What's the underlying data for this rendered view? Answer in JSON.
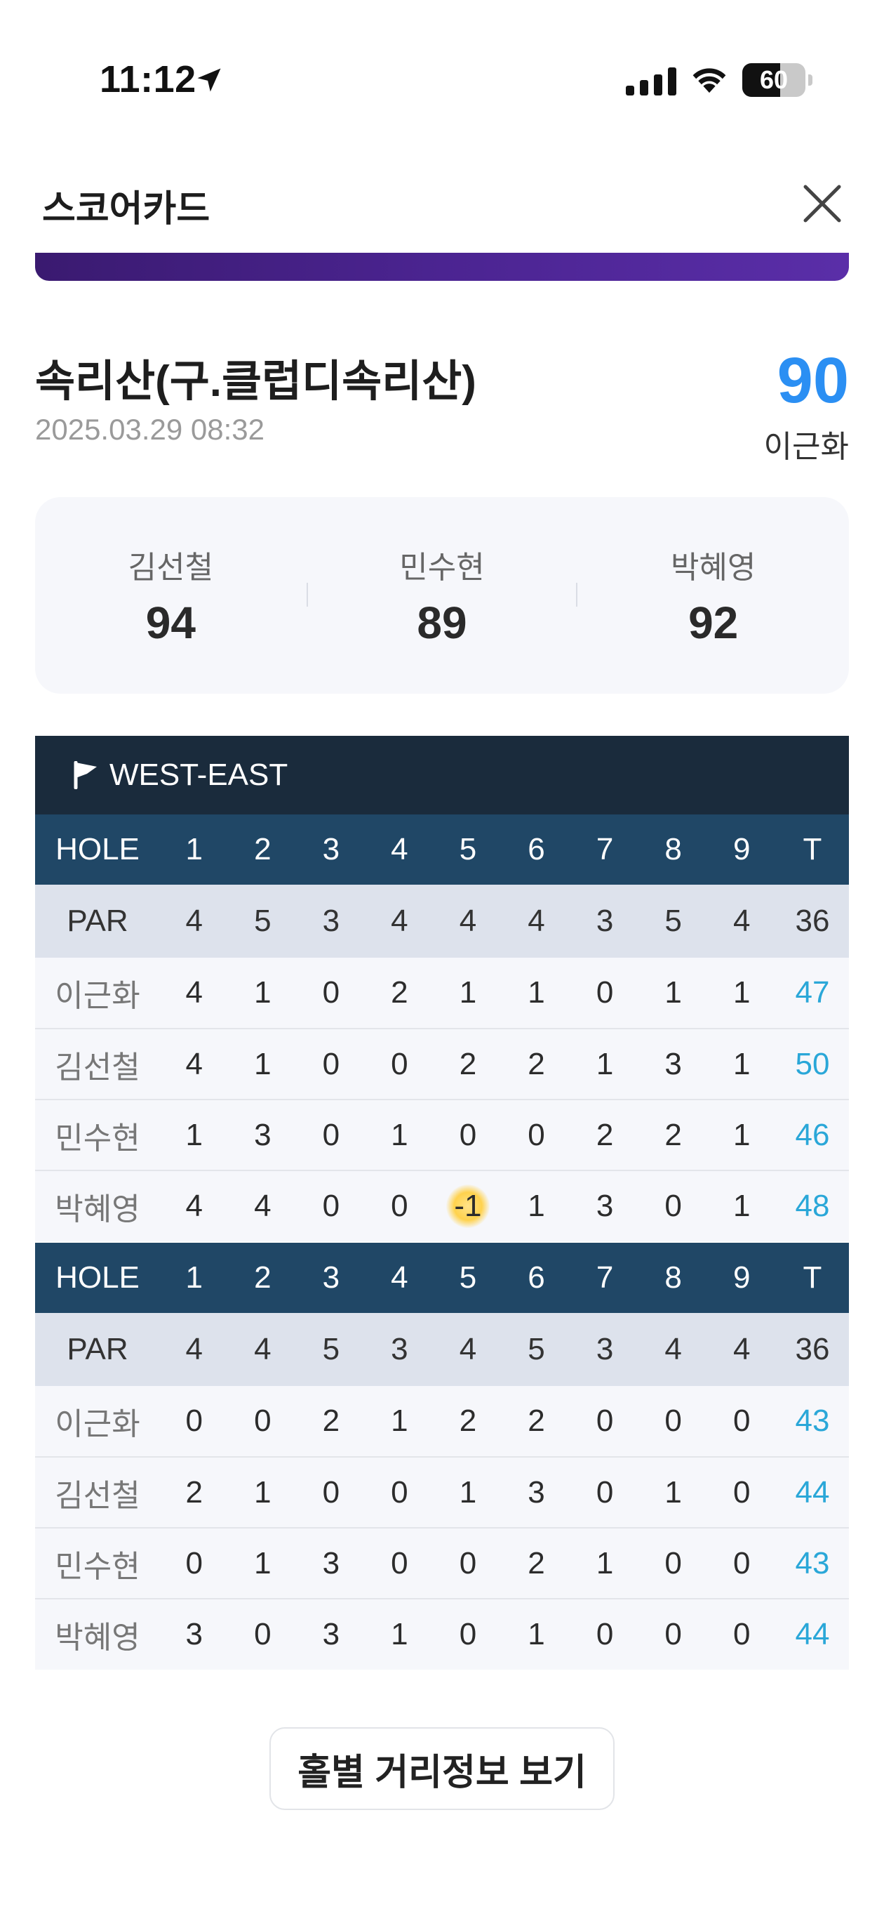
{
  "status_bar": {
    "time": "11:12",
    "battery": "60",
    "battery_level": 0.6
  },
  "header": {
    "title": "스코어카드"
  },
  "course": {
    "name": "속리산(구.클럽디속리산)",
    "date": "2025.03.29 08:32",
    "my_score": "90",
    "my_name": "이근화"
  },
  "summary": [
    {
      "name": "김선철",
      "score": "94"
    },
    {
      "name": "민수현",
      "score": "89"
    },
    {
      "name": "박혜영",
      "score": "92"
    }
  ],
  "scorecard": {
    "course_label": "WEST-EAST",
    "halves": [
      {
        "hole_label": "HOLE",
        "holes": [
          "1",
          "2",
          "3",
          "4",
          "5",
          "6",
          "7",
          "8",
          "9",
          "T"
        ],
        "par_label": "PAR",
        "par": [
          "4",
          "5",
          "3",
          "4",
          "4",
          "4",
          "3",
          "5",
          "4",
          "36"
        ],
        "players": [
          {
            "name": "이근화",
            "scores": [
              "4",
              "1",
              "0",
              "2",
              "1",
              "1",
              "0",
              "1",
              "1"
            ],
            "total": "47"
          },
          {
            "name": "김선철",
            "scores": [
              "4",
              "1",
              "0",
              "0",
              "2",
              "2",
              "1",
              "3",
              "1"
            ],
            "total": "50"
          },
          {
            "name": "민수현",
            "scores": [
              "1",
              "3",
              "0",
              "1",
              "0",
              "0",
              "2",
              "2",
              "1"
            ],
            "total": "46"
          },
          {
            "name": "박혜영",
            "scores": [
              "4",
              "4",
              "0",
              "0",
              "-1",
              "1",
              "3",
              "0",
              "1"
            ],
            "total": "48"
          }
        ]
      },
      {
        "hole_label": "HOLE",
        "holes": [
          "1",
          "2",
          "3",
          "4",
          "5",
          "6",
          "7",
          "8",
          "9",
          "T"
        ],
        "par_label": "PAR",
        "par": [
          "4",
          "4",
          "5",
          "3",
          "4",
          "5",
          "3",
          "4",
          "4",
          "36"
        ],
        "players": [
          {
            "name": "이근화",
            "scores": [
              "0",
              "0",
              "2",
              "1",
              "2",
              "2",
              "0",
              "0",
              "0"
            ],
            "total": "43"
          },
          {
            "name": "김선철",
            "scores": [
              "2",
              "1",
              "0",
              "0",
              "1",
              "3",
              "0",
              "1",
              "0"
            ],
            "total": "44"
          },
          {
            "name": "민수현",
            "scores": [
              "0",
              "1",
              "3",
              "0",
              "0",
              "2",
              "1",
              "0",
              "0"
            ],
            "total": "43"
          },
          {
            "name": "박혜영",
            "scores": [
              "3",
              "0",
              "3",
              "1",
              "0",
              "1",
              "0",
              "0",
              "0"
            ],
            "total": "44"
          }
        ]
      }
    ]
  },
  "button": {
    "label": "홀별 거리정보 보기"
  },
  "colors": {
    "accent": "#2b8ff3",
    "total": "#2aa7d8",
    "table_header": "#204766",
    "course_header": "#1a2b3c"
  }
}
